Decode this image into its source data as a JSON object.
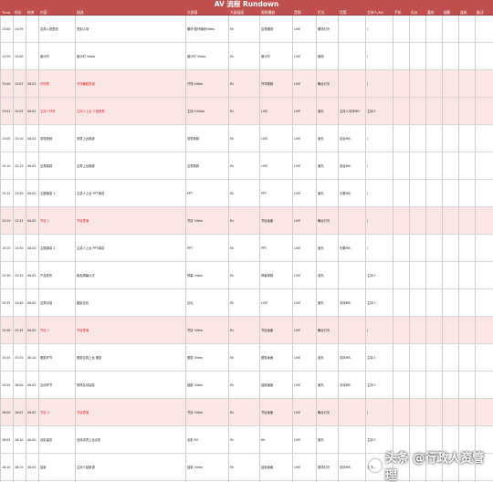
{
  "title": "AV 流程 Rundown",
  "header": [
    "Time",
    "时长",
    "结束",
    "内容",
    "描述",
    "大屏幕",
    "大屏画面",
    "视频播放",
    "音频",
    "灯光",
    "话筒",
    "主持人/MC",
    "手机",
    "礼仪",
    "嘉宾",
    "摄影",
    "道具",
    "备注"
  ],
  "rows": [
    {
      "time": "13:00",
      "dur": "14:59",
      "end": "",
      "content": "嘉宾入场签到",
      "desc": "签到入场",
      "ledl": "暖场 循环播放Video",
      "led": "KV",
      "video": "嘉宾暖场",
      "audio": "LIVE",
      "light": "暖场灯光",
      "mic": "",
      "mc": "/",
      "shade": false,
      "red": false
    },
    {
      "time": "14:59",
      "dur": "15:00",
      "end": "",
      "content": "倒计时",
      "desc": "倒计时 Video",
      "ledl": "倒计时 Video",
      "led": "KV",
      "video": "倒计时",
      "audio": "LIVE",
      "light": "暗场",
      "mic": "",
      "mc": "/",
      "shade": false,
      "red": false
    },
    {
      "time": "15:00",
      "dur": "15:03",
      "end": "00:03",
      "content": "开场秀",
      "desc": "开场舞蹈表演",
      "ledl": "开场 Video",
      "led": "KV",
      "video": "开场视频",
      "audio": "LIVE",
      "light": "舞台灯光",
      "mic": "",
      "mc": "/",
      "shade": true,
      "red": true
    },
    {
      "time": "15:03",
      "dur": "15:05",
      "end": "00:02",
      "content": "主持人开场",
      "desc": "主持人上台 介绍来宾",
      "ledl": "主持人Video",
      "led": "KV",
      "video": "LIVE",
      "audio": "LIVE",
      "light": "面光",
      "mic": "主持人手持MIC",
      "mc": "主持人",
      "shade": true,
      "red": true
    },
    {
      "time": "15:05",
      "dur": "15:10",
      "end": "00:05",
      "content": "领导致辞",
      "desc": "领导上台致辞",
      "ledl": "领导致辞",
      "led": "KV",
      "video": "LIVE",
      "audio": "LIVE",
      "light": "面光",
      "mic": "讲台MIC",
      "mc": "/",
      "shade": false,
      "red": false
    },
    {
      "time": "15:10",
      "dur": "15:15",
      "end": "00:05",
      "content": "嘉宾致辞",
      "desc": "嘉宾上台致辞",
      "ledl": "嘉宾致辞",
      "led": "KV",
      "video": "LIVE",
      "audio": "LIVE",
      "light": "面光",
      "mic": "讲台MIC",
      "mc": "/",
      "shade": false,
      "red": false
    },
    {
      "time": "15:15",
      "dur": "15:20",
      "end": "00:05",
      "content": "主题演讲 1",
      "desc": "主讲人上台 PPT演讲",
      "ledl": "PPT",
      "led": "KV",
      "video": "PPT",
      "audio": "LIVE",
      "light": "面光",
      "mic": "头戴MIC",
      "mc": "/",
      "shade": false,
      "red": false
    },
    {
      "time": "15:20",
      "dur": "15:25",
      "end": "00:05",
      "content": "节目 1",
      "desc": "节目表演",
      "ledl": "节目 Video",
      "led": "KV",
      "video": "节目画面",
      "audio": "LIVE",
      "light": "舞台灯光",
      "mic": "",
      "mc": "/",
      "shade": true,
      "red": true
    },
    {
      "time": "15:25",
      "dur": "15:30",
      "end": "00:05",
      "content": "主题演讲 2",
      "desc": "主讲人上台 PPT演讲",
      "ledl": "PPT",
      "led": "KV",
      "video": "PPT",
      "audio": "LIVE",
      "light": "面光",
      "mic": "头戴MIC",
      "mc": "/",
      "shade": false,
      "red": false
    },
    {
      "time": "15:30",
      "dur": "15:35",
      "end": "00:05",
      "content": "产品发布",
      "desc": "新品揭幕仪式",
      "ledl": "揭幕 Video",
      "led": "KV",
      "video": "揭幕视频",
      "audio": "LIVE",
      "light": "追光",
      "mic": "",
      "mc": "主持人",
      "shade": false,
      "red": false
    },
    {
      "time": "15:35",
      "dur": "15:40",
      "end": "00:05",
      "content": "嘉宾对话",
      "desc": "圆桌论坛",
      "ledl": "论坛",
      "led": "KV",
      "video": "LIVE",
      "audio": "LIVE",
      "light": "面光",
      "mic": "手持MIC",
      "mc": "主持人",
      "shade": false,
      "red": false
    },
    {
      "time": "15:40",
      "dur": "15:45",
      "end": "00:05",
      "content": "节目 2",
      "desc": "节目表演",
      "ledl": "节目 Video",
      "led": "KV",
      "video": "节目画面",
      "audio": "LIVE",
      "light": "舞台灯光",
      "mic": "",
      "mc": "/",
      "shade": true,
      "red": true
    },
    {
      "time": "15:45",
      "dur": "15:55",
      "end": "00:10",
      "content": "颁奖环节",
      "desc": "颁奖嘉宾上台 颁奖",
      "ledl": "颁奖 Video",
      "led": "KV",
      "video": "颁奖画面",
      "audio": "LIVE",
      "light": "追光",
      "mic": "手持MIC",
      "mc": "主持人",
      "shade": false,
      "red": false
    },
    {
      "time": "15:55",
      "dur": "16:00",
      "end": "00:05",
      "content": "互动环节",
      "desc": "现场互动抽奖",
      "ledl": "抽奖 Video",
      "led": "KV",
      "video": "抽奖画面",
      "audio": "LIVE",
      "light": "面光",
      "mic": "手持MIC",
      "mc": "主持人",
      "shade": false,
      "red": false
    },
    {
      "time": "16:00",
      "dur": "16:05",
      "end": "00:05",
      "content": "节目 3",
      "desc": "节目表演",
      "ledl": "节目 Video",
      "led": "KV",
      "video": "节目画面",
      "audio": "LIVE",
      "light": "舞台灯光",
      "mic": "",
      "mc": "/",
      "shade": true,
      "red": true
    },
    {
      "time": "16:05",
      "dur": "16:10",
      "end": "00:05",
      "content": "合影留念",
      "desc": "全体嘉宾上台合影",
      "ledl": "合影 KV",
      "led": "KV",
      "video": "KV",
      "audio": "LIVE",
      "light": "面光",
      "mic": "",
      "mc": "主持人",
      "shade": false,
      "red": false
    },
    {
      "time": "16:10",
      "dur": "16:15",
      "end": "00:05",
      "content": "结束",
      "desc": "主持人结束语",
      "ledl": "结束 Video",
      "led": "KV",
      "video": "结束画面",
      "audio": "LIVE",
      "light": "散场灯光",
      "mic": "手持MIC",
      "mc": "主持人",
      "shade": false,
      "red": false
    }
  ],
  "watermark": "头条 @行政人资管理"
}
